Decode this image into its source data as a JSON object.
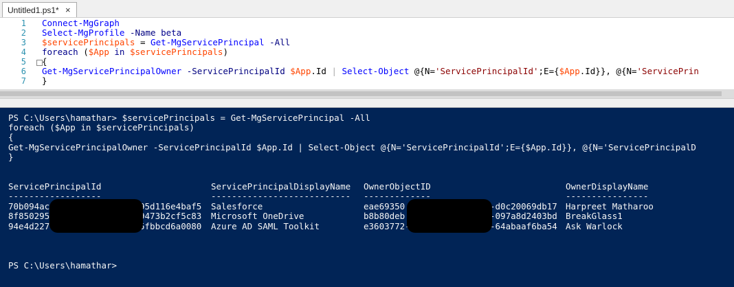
{
  "tab": {
    "title": "Untitled1.ps1*",
    "close": "×"
  },
  "editor": {
    "line_numbers": [
      "1",
      "2",
      "3",
      "4",
      "5",
      "6",
      "7"
    ],
    "lines": [
      [
        {
          "t": "Connect-MgGraph",
          "c": "cmd"
        }
      ],
      [
        {
          "t": "Select-MgProfile",
          "c": "cmd"
        },
        {
          "t": " -Name",
          "c": "par"
        },
        {
          "t": " beta",
          "c": "key"
        }
      ],
      [
        {
          "t": "$servicePrincipals",
          "c": "var"
        },
        {
          "t": " = ",
          "c": "plain"
        },
        {
          "t": "Get-MgServicePrincipal",
          "c": "cmd"
        },
        {
          "t": " -All",
          "c": "par"
        }
      ],
      [
        {
          "t": "foreach",
          "c": "key"
        },
        {
          "t": " (",
          "c": "plain"
        },
        {
          "t": "$App",
          "c": "var"
        },
        {
          "t": " in ",
          "c": "key"
        },
        {
          "t": "$servicePrincipals",
          "c": "var"
        },
        {
          "t": ")",
          "c": "plain"
        }
      ],
      [
        {
          "t": "{",
          "c": "plain"
        }
      ],
      [
        {
          "t": "Get-MgServicePrincipalOwner",
          "c": "cmd"
        },
        {
          "t": " -ServicePrincipalId",
          "c": "par"
        },
        {
          "t": " $App",
          "c": "var"
        },
        {
          "t": ".Id",
          "c": "plain"
        },
        {
          "t": " | ",
          "c": "op"
        },
        {
          "t": "Select-Object",
          "c": "cmd"
        },
        {
          "t": " @{N=",
          "c": "plain"
        },
        {
          "t": "'ServicePrincipalId'",
          "c": "str"
        },
        {
          "t": ";E={",
          "c": "plain"
        },
        {
          "t": "$App",
          "c": "var"
        },
        {
          "t": ".Id}}, @{N=",
          "c": "plain"
        },
        {
          "t": "'ServicePrin",
          "c": "str"
        }
      ],
      [
        {
          "t": "}",
          "c": "plain"
        }
      ]
    ]
  },
  "console": {
    "command_lines": [
      "PS C:\\Users\\hamathar> $servicePrincipals = Get-MgServicePrincipal -All",
      "foreach ($App in $servicePrincipals)",
      "{",
      "Get-MgServicePrincipalOwner -ServicePrincipalId $App.Id | Select-Object @{N='ServicePrincipalId';E={$App.Id}}, @{N='ServicePrincipalD",
      "}"
    ],
    "table": {
      "headers": [
        "ServicePrincipalId",
        "ServicePrincipalDisplayName",
        "OwnerObjectID",
        "OwnerDisplayName"
      ],
      "dashes": [
        "------------------",
        "---------------------------",
        "-------------",
        "----------------"
      ],
      "rows": [
        [
          "70b094ac",
          "95d116e4baf5",
          "Salesforce",
          "eae69350",
          "-d0c20069db17",
          "Harpreet Matharoo"
        ],
        [
          "8f850295",
          "9473b2cf5c83",
          "Microsoft OneDrive",
          "b8b80deb",
          "-097a8d2403bd",
          "BreakGlass1"
        ],
        [
          "94e4d227",
          "5fbbcd6a0080",
          "Azure AD SAML Toolkit",
          "e3603772-",
          "-64abaaf6ba54",
          "Ask Warlock"
        ]
      ]
    },
    "prompt": "PS C:\\Users\\hamathar>"
  },
  "colors": {
    "console_bg": "#012456",
    "console_text": "#f5f5f5",
    "line_number": "#2b91af",
    "cmdlet": "#0000ff",
    "variable": "#ff4500",
    "parameter": "#000080",
    "keyword": "#00008b",
    "string": "#8b0000"
  }
}
